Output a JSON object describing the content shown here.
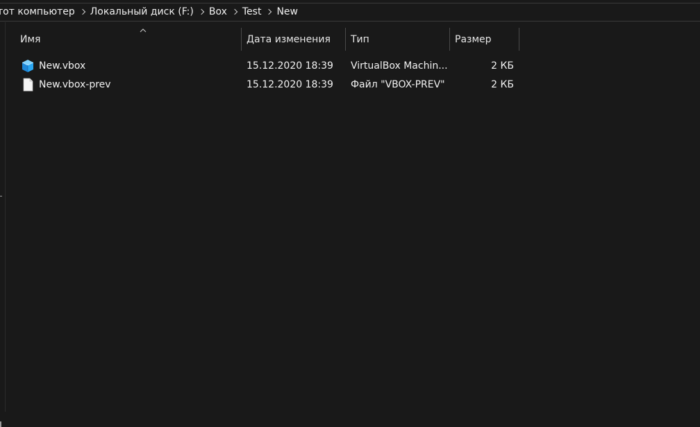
{
  "breadcrumb": {
    "items": [
      "тот компьютер",
      "Локальный диск (F:)",
      "Box",
      "Test",
      "New"
    ]
  },
  "columns": {
    "name": "Имя",
    "date": "Дата изменения",
    "type": "Тип",
    "size": "Размер"
  },
  "files": [
    {
      "name": "New.vbox",
      "date": "15.12.2020 18:39",
      "type": "VirtualBox Machin...",
      "size": "2 КБ",
      "icon": "virtualbox-cube-icon"
    },
    {
      "name": "New.vbox-prev",
      "date": "15.12.2020 18:39",
      "type": "Файл \"VBOX-PREV\"",
      "size": "2 КБ",
      "icon": "blank-file-icon"
    }
  ]
}
